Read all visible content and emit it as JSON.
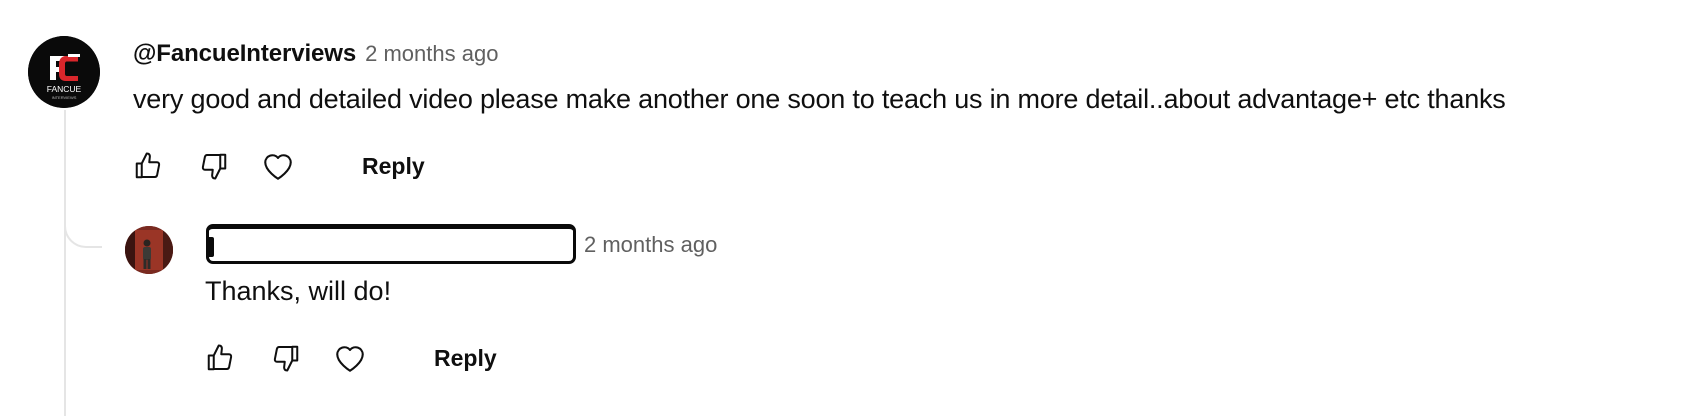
{
  "comment": {
    "author": "@FancueInterviews",
    "time": "2 months ago",
    "text": "very good and detailed video please make another one soon to teach us in more detail..about advantage+ etc thanks",
    "avatar_label": "FANCUE",
    "avatar_sublabel": "INTERVIEWS",
    "avatar_icon": "fancue-logo-icon",
    "actions": {
      "like_icon": "thumbs-up-icon",
      "dislike_icon": "thumbs-down-icon",
      "heart_icon": "heart-icon",
      "reply_label": "Reply"
    }
  },
  "reply": {
    "author_redacted": true,
    "time": "2 months ago",
    "text": "Thanks, will do!",
    "avatar_icon": "user-photo-avatar",
    "actions": {
      "like_icon": "thumbs-up-icon",
      "dislike_icon": "thumbs-down-icon",
      "heart_icon": "heart-icon",
      "reply_label": "Reply"
    }
  },
  "colors": {
    "text_primary": "#0f0f0f",
    "text_secondary": "#606060",
    "thread_line": "#e5e5e5",
    "avatar_bg": "#0a0a0a",
    "logo_red": "#d9262b"
  }
}
